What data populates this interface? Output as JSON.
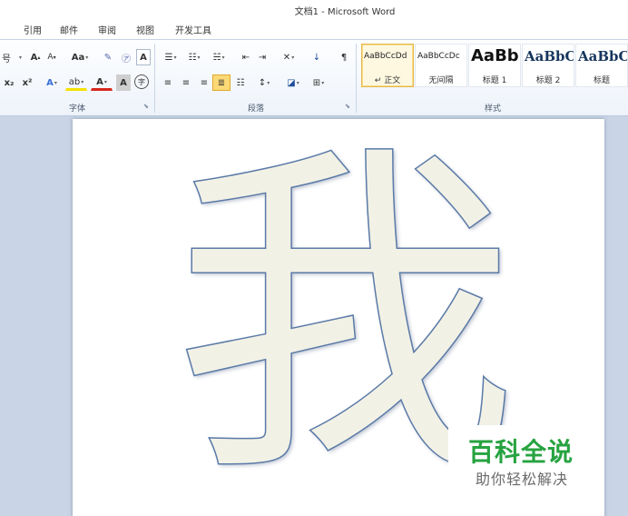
{
  "window": {
    "title": "文档1 - Microsoft Word"
  },
  "menu": {
    "items": [
      {
        "label": "引用"
      },
      {
        "label": "邮件"
      },
      {
        "label": "审阅"
      },
      {
        "label": "视图"
      },
      {
        "label": "开发工具"
      }
    ]
  },
  "ribbon": {
    "font_group": {
      "label": "字体",
      "font_size_suffix": "号",
      "grow_font": "A",
      "shrink_font": "A",
      "change_case": "Aa",
      "phonetic_guide": "㋐",
      "char_border": "A",
      "subscript": "x₂",
      "superscript": "x²",
      "text_effects": "A",
      "highlight": "ab",
      "font_color": "A",
      "char_shading": "A",
      "enclose_char": "字"
    },
    "paragraph_group": {
      "label": "段落"
    },
    "styles_group": {
      "label": "样式",
      "styles": [
        {
          "sample": "AaBbCcDd",
          "name": "↵ 正文",
          "selected": true
        },
        {
          "sample": "AaBbCcDc",
          "name": "无间隔",
          "selected": false
        },
        {
          "sample": "AaBb",
          "name": "标题 1",
          "selected": false
        },
        {
          "sample": "AaBbC",
          "name": "标题 2",
          "selected": false
        },
        {
          "sample": "AaBbC",
          "name": "标题",
          "selected": false
        }
      ]
    }
  },
  "document": {
    "content": "我"
  },
  "watermark": {
    "title": "百科全说",
    "subtitle": "助你轻松解决"
  },
  "colors": {
    "accent": "#27a340",
    "page_bg": "#ffffff",
    "workspace_bg": "#c9d5e6",
    "char_fill": "#f2f1e6",
    "char_outline": "#5a7aa7"
  }
}
